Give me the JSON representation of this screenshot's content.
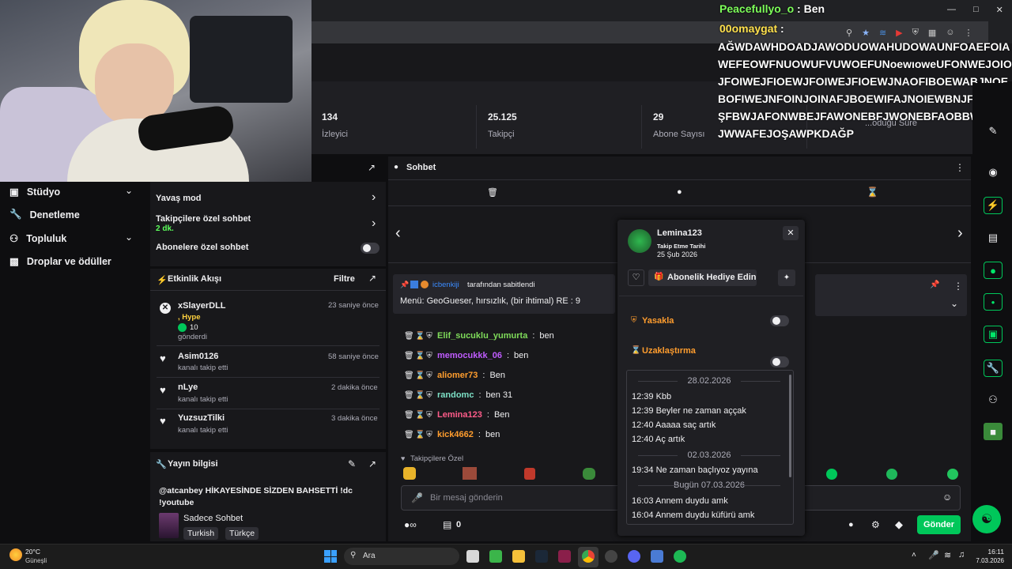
{
  "overlay": {
    "user1": "Peacefullyo_o",
    "sep": ":",
    "msg1": "Ben",
    "user2": "00omaygat",
    "lines": [
      "AĞWDAWHDOADJAWODUOWAHUDOWAUNFOAEFOIA",
      "WEFEOWFNUOWUFVUWOEFUNoewıoweUFONWEJOIO",
      "JFOIWEJFIOEWJFOIWEJFIOEWJNAOFIBOEWABJNOE",
      "BOFIWEJNFOINJOINAFJBOEWIFAJNOIEWBNJFOEWJA",
      "ŞFBWJAFONWBEJFAWONEBFJWONEBFAOBBWANFEO",
      "JWWAFEJOŞAWPKDAĞP"
    ]
  },
  "stats": [
    {
      "value": "134",
      "label": "İzleyici"
    },
    {
      "value": "25.125",
      "label": "Takipçi"
    },
    {
      "value": "29",
      "label": "Abone Sayısı"
    },
    {
      "value": "",
      "label": "...oduğu Süre"
    }
  ],
  "leftnav": {
    "items": [
      "Stüdyo",
      "Denetleme",
      "Topluluk",
      "Droplar ve ödüller"
    ]
  },
  "mod_settings": {
    "slow_mode": "Yavaş mod",
    "followers_only": "Takipçilere özel sohbet",
    "followers_duration": "2 dk.",
    "subs_only": "Abonelere özel sohbet"
  },
  "activity": {
    "title": "Etkinlik Akışı",
    "filter": "Filtre",
    "items": [
      {
        "user": "xSlayerDLL",
        "time": "23 saniye önce",
        "extra": ", Hype",
        "count": "10",
        "action": "gönderdi"
      },
      {
        "user": "Asim0126",
        "time": "58 saniye önce",
        "action": "kanalı takip etti"
      },
      {
        "user": "nLye",
        "time": "2 dakika önce",
        "action": "kanalı takip etti"
      },
      {
        "user": "YuzsuzTilki",
        "time": "3 dakika önce",
        "action": "kanalı takip etti"
      }
    ]
  },
  "stream_info": {
    "title": "Yayın bilgisi",
    "text1": "@atcanbey HİKAYESİNDE SİZDEN BAHSETTİ !dc",
    "text2": "!youtube",
    "category": "Sadece Sohbet",
    "tags": [
      "Turkish",
      "Türkçe"
    ]
  },
  "chat": {
    "title": "Sohbet",
    "pinned_by": "icbenkiji",
    "pinned_suffix": "tarafından sabitlendi",
    "pinned_text": "Menü: GeoGueser, hırsızlık, (bir ihtimal) RE : 9",
    "messages": [
      {
        "user": "Elif_sucuklu_yumurta",
        "text": "ben",
        "color": "#7fdc5a"
      },
      {
        "user": "memocukkk_06",
        "text": "ben",
        "color": "#c05cff"
      },
      {
        "user": "aliomer73",
        "text": "Ben",
        "color": "#ff9d2e"
      },
      {
        "user": "randomc",
        "text": "ben 31",
        "color": "#7de0c6"
      },
      {
        "user": "Lemina123",
        "text": "Ben",
        "color": "#ff5c8a"
      },
      {
        "user": "kick4662",
        "text": "ben",
        "color": "#ff9d2e"
      }
    ],
    "followers_only": "Takipçilere Özel",
    "input_placeholder": "Bir mesaj gönderin",
    "points": "0",
    "send": "Gönder"
  },
  "user_card": {
    "name": "Lemina123",
    "follow_label": "Takip Etme Tarihi",
    "follow_date": "25 Şub 2026",
    "gift": "Abonelik Hediye Edin",
    "ban": "Yasakla",
    "timeout": "Uzaklaştırma",
    "history": [
      {
        "date": "28.02.2026"
      },
      {
        "time": "12:39",
        "text": "Kbb"
      },
      {
        "time": "12:39",
        "text": "Beyler ne zaman aççak"
      },
      {
        "time": "12:40",
        "text": "Aaaaa saç artık"
      },
      {
        "time": "12:40",
        "text": "Aç artık"
      },
      {
        "date": "02.03.2026"
      },
      {
        "time": "19:34",
        "text": "Ne zaman baçlıyoz yayına"
      },
      {
        "date": "Bugün 07.03.2026"
      },
      {
        "time": "16:03",
        "text": "Annem duydu amk"
      },
      {
        "time": "16:04",
        "text": "Annem duydu küfürü amk"
      }
    ]
  },
  "taskbar": {
    "weather_temp": "20°C",
    "weather_text": "Güneşli",
    "search": "Ara",
    "time": "16:11",
    "date": "7.03.2026"
  },
  "colors": {
    "accent": "#00c75a",
    "panel": "#18181b",
    "bg": "#0e0e10"
  }
}
